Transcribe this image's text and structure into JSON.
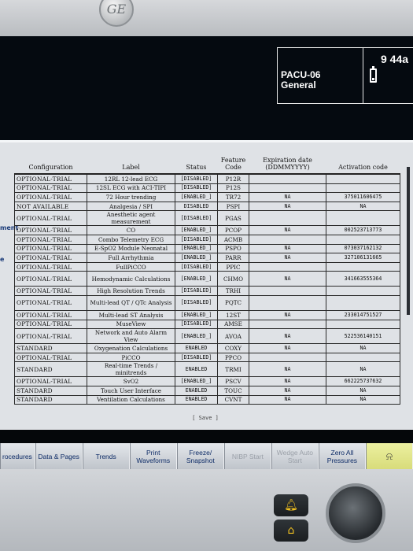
{
  "header": {
    "location": "PACU-06",
    "profile": "General",
    "clock": "9 44a",
    "battery_level": 0.25
  },
  "side_labels": [
    "ment",
    "e"
  ],
  "table": {
    "columns": [
      "Configuration",
      "Label",
      "Status",
      "Feature Code",
      "Expiration date (DDMMYYYY)",
      "Activation code"
    ],
    "rows": [
      [
        "OPTIONAL-TRIAL",
        "12RL 12-lead ECG",
        "[DISABLED]",
        "P12R",
        "",
        ""
      ],
      [
        "OPTIONAL-TRIAL",
        "12SL ECG with ACI-TIPI",
        "[DISABLED]",
        "P12S",
        "",
        ""
      ],
      [
        "OPTIONAL-TRIAL",
        "72 Hour trending",
        "[ENABLED_]",
        "TR72",
        "NA",
        "375011606475"
      ],
      [
        "NOT AVAILABLE",
        "Analgesia / SPI",
        "DISABLED",
        "PSPI",
        "NA",
        "NA"
      ],
      [
        "OPTIONAL-TRIAL",
        "Anesthetic agent measurement",
        "[DISABLED]",
        "PGAS",
        "",
        ""
      ],
      [
        "OPTIONAL-TRIAL",
        "CO",
        "[ENABLED_]",
        "PCOP",
        "NA",
        "002523713773"
      ],
      [
        "OPTIONAL-TRIAL",
        "Combo Telemetry ECG",
        "[DISABLED]",
        "ACMB",
        "",
        ""
      ],
      [
        "OPTIONAL-TRIAL",
        "E-SpO2 Module Neonatal",
        "[ENABLED_]",
        "PSPO",
        "NA",
        "073037162132"
      ],
      [
        "OPTIONAL-TRIAL",
        "Full Arrhythmia",
        "[ENABLED_]",
        "PARR",
        "NA",
        "327106131665"
      ],
      [
        "OPTIONAL-TRIAL",
        "FullPiCCO",
        "[DISABLED]",
        "PPIC",
        "",
        ""
      ],
      [
        "OPTIONAL-TRIAL",
        "Hemodynamic Calculations",
        "[ENABLED_]",
        "CHMO",
        "NA",
        "341663555364"
      ],
      [
        "OPTIONAL-TRIAL",
        "High Resolution Trends",
        "[DISABLED]",
        "TRHI",
        "",
        ""
      ],
      [
        "OPTIONAL-TRIAL",
        "Multi-lead QT / QTc Analysis",
        "[DISABLED]",
        "PQTC",
        "",
        ""
      ],
      [
        "OPTIONAL-TRIAL",
        "Multi-lead ST Analysis",
        "[ENABLED_]",
        "12ST",
        "NA",
        "233014751527"
      ],
      [
        "OPTIONAL-TRIAL",
        "MuseView",
        "[DISABLED]",
        "AMSE",
        "",
        ""
      ],
      [
        "OPTIONAL-TRIAL",
        "Network and Auto Alarm View",
        "[ENABLED_]",
        "AVOA",
        "NA",
        "522536140151"
      ],
      [
        "STANDARD",
        "Oxygenation Calculations",
        "ENABLED",
        "COXY",
        "NA",
        "NA"
      ],
      [
        "OPTIONAL-TRIAL",
        "PiCCO",
        "[DISABLED]",
        "PPCO",
        "",
        ""
      ],
      [
        "STANDARD",
        "Real-time Trends / minitrends",
        "ENABLED",
        "TRMI",
        "NA",
        "NA"
      ],
      [
        "OPTIONAL-TRIAL",
        "SvO2",
        "[ENABLED_]",
        "PSCV",
        "NA",
        "662225737632"
      ],
      [
        "STANDARD",
        "Touch User Interface",
        "ENABLED",
        "TOUC",
        "NA",
        "NA"
      ],
      [
        "STANDARD",
        "Ventilation Calculations",
        "ENABLED",
        "CVNT",
        "NA",
        "NA"
      ]
    ],
    "tall_rows": [
      4,
      10,
      12,
      15,
      18
    ],
    "save_label": "[ Save ]"
  },
  "menu": {
    "buttons": [
      {
        "label": "rocedures",
        "enabled": true
      },
      {
        "label": "Data & Pages",
        "enabled": true
      },
      {
        "label": "Trends",
        "enabled": true
      },
      {
        "label": "Print Waveforms",
        "enabled": true
      },
      {
        "label": "Freeze/ Snapshot",
        "enabled": true
      },
      {
        "label": "NIBP Start",
        "enabled": false
      },
      {
        "label": "Wedge Auto Start",
        "enabled": false
      },
      {
        "label": "Zero All Pressures",
        "enabled": true
      },
      {
        "label": "",
        "enabled": true,
        "icon": "alarm-bell-icon"
      }
    ]
  },
  "device": {
    "logo": "GE",
    "hw_buttons": [
      "alarm-silence-icon",
      "home-icon"
    ]
  }
}
